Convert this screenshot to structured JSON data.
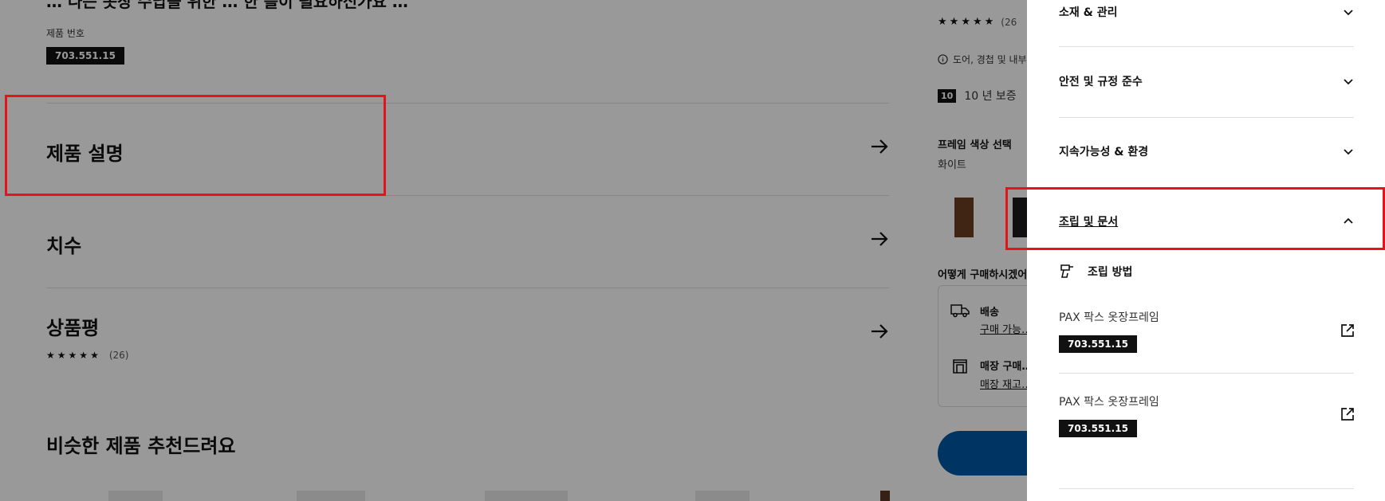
{
  "main": {
    "cut_heading": "… 나는 옷장 수납을 위한 … 한 틀이 필요하신가요 …",
    "product_number_label": "제품 번호",
    "product_number": "703.551.15",
    "sections": [
      {
        "title": "제품 설명"
      },
      {
        "title": "치수"
      },
      {
        "title": "상품평",
        "rating_count": "(26)"
      }
    ],
    "similar_heading": "비슷한 제품 추천드려요"
  },
  "right_column": {
    "rating_count": "(26",
    "note": "도어, 경첩 및 내부…",
    "warranty_years": "10",
    "warranty_text": "10 년 보증",
    "frame_color_label": "프레임 색상 선택",
    "frame_color_value": "화이트",
    "how_to_buy": "어떻게 구매하시겠어…",
    "delivery_title": "배송",
    "delivery_link": "구매 가능…",
    "store_title": "매장 구매…",
    "store_link": "매장 재고…",
    "colors": {
      "swatch_brown": "#6b3f24",
      "swatch_black": "#1c1c1c",
      "button": "#0058a3"
    }
  },
  "panel": {
    "accordion": [
      {
        "label": "소재 & 관리",
        "expanded": false
      },
      {
        "label": "안전 및 규정 준수",
        "expanded": false
      },
      {
        "label": "지속가능성 & 환경",
        "expanded": false
      },
      {
        "label": "조립 및 문서",
        "expanded": true
      }
    ],
    "assembly_label": "조립 방법",
    "documents": [
      {
        "name": "PAX 팍스 옷장프레임",
        "number": "703.551.15"
      },
      {
        "name": "PAX 팍스 옷장프레임",
        "number": "703.551.15"
      }
    ]
  },
  "highlight_color": "#e5141b"
}
